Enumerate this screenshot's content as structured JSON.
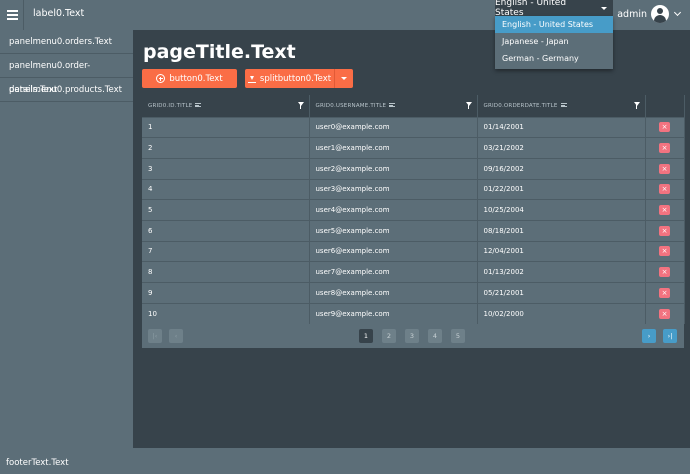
{
  "header": {
    "app_title": "label0.Text",
    "language_selected": "English - United States",
    "user_name": "admin"
  },
  "language_options": [
    "English - United States",
    "Japanese - Japan",
    "German - Germany"
  ],
  "sidebar": {
    "items": [
      {
        "label": "panelmenu0.orders.Text"
      },
      {
        "label": "panelmenu0.order-details.Text"
      },
      {
        "label": "panelmenu0.products.Text"
      }
    ]
  },
  "main": {
    "page_title": "pageTitle.Text",
    "button_label": "button0.Text",
    "split_button_label": "splitbutton0.Text"
  },
  "grid": {
    "columns": [
      "GRID0.ID.TITLE",
      "GRID0.USERNAME.TITLE",
      "GRID0.ORDERDATE.TITLE"
    ],
    "delete_glyph": "×",
    "rows": [
      {
        "id": "1",
        "username": "user0@example.com",
        "orderdate": "01/14/2001"
      },
      {
        "id": "2",
        "username": "user1@example.com",
        "orderdate": "03/21/2002"
      },
      {
        "id": "3",
        "username": "user2@example.com",
        "orderdate": "09/16/2002"
      },
      {
        "id": "4",
        "username": "user3@example.com",
        "orderdate": "01/22/2001"
      },
      {
        "id": "5",
        "username": "user4@example.com",
        "orderdate": "10/25/2004"
      },
      {
        "id": "6",
        "username": "user5@example.com",
        "orderdate": "08/18/2001"
      },
      {
        "id": "7",
        "username": "user6@example.com",
        "orderdate": "12/04/2001"
      },
      {
        "id": "8",
        "username": "user7@example.com",
        "orderdate": "01/13/2002"
      },
      {
        "id": "9",
        "username": "user8@example.com",
        "orderdate": "05/21/2001"
      },
      {
        "id": "10",
        "username": "user9@example.com",
        "orderdate": "10/02/2000"
      }
    ]
  },
  "pager": {
    "pages": [
      "1",
      "2",
      "3",
      "4",
      "5"
    ],
    "current_page": "1",
    "first_glyph": "|‹",
    "prev_glyph": "‹",
    "next_glyph": "›",
    "last_glyph": "›|"
  },
  "footer": {
    "text": "footerText.Text"
  },
  "colors": {
    "accent": "#fa6d46",
    "selection": "#479cc8",
    "delete": "#f27380",
    "panel": "#5c6e78",
    "background": "#37434b"
  }
}
